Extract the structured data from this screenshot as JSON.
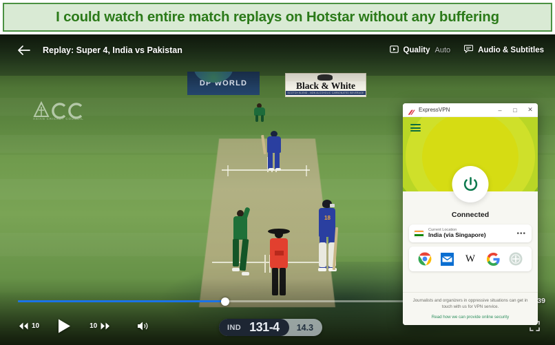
{
  "banner": {
    "text": "I could watch entire match replays on Hotstar without any buffering"
  },
  "player": {
    "back_icon": "back-arrow-icon",
    "title": "Replay: Super 4, India vs Pakistan",
    "quality": {
      "icon": "quality-icon",
      "label": "Quality",
      "value": "Auto"
    },
    "audio": {
      "icon": "subtitles-icon",
      "label": "Audio & Subtitles"
    },
    "progress": {
      "percent": 41,
      "time_remaining": "3:39:39"
    },
    "controls": {
      "rewind_label": "10",
      "rewind_icon": "rewind-10-icon",
      "play_icon": "play-icon",
      "forward_label": "10",
      "forward_icon": "forward-10-icon",
      "volume_icon": "volume-icon",
      "fullscreen_icon": "fullscreen-icon"
    },
    "score": {
      "team": "IND",
      "runs": "131-4",
      "overs": "14.3"
    }
  },
  "broadcast": {
    "logo": {
      "text": "ACC",
      "subtitle": "ASIAN CRICKET COUNCIL"
    },
    "ads": [
      {
        "name": "DP WORLD"
      },
      {
        "name": "Black & White",
        "tagline": "SCOTCH BLEND - NON ALCOHOLIC CARBONATED BEVERAGE"
      }
    ]
  },
  "vpn": {
    "app_name": "ExpressVPN",
    "logo_icon": "expressvpn-logo-icon",
    "window_buttons": {
      "minimize": "–",
      "maximize": "□",
      "close": "✕"
    },
    "menu_icon": "hamburger-menu-icon",
    "power_icon": "power-icon",
    "status": "Connected",
    "location": {
      "caption": "Current Location",
      "value": "India (via Singapore)",
      "flag_icon": "india-flag-icon",
      "more_icon": "more-options-icon",
      "flag_colors": [
        "#FF9933",
        "#FFFFFF",
        "#138808"
      ]
    },
    "shortcuts": [
      {
        "name": "chrome-icon"
      },
      {
        "name": "mail-icon"
      },
      {
        "name": "wikipedia-icon"
      },
      {
        "name": "google-icon"
      },
      {
        "name": "add-shortcut-icon"
      }
    ],
    "footer": {
      "text": "Journalists and organizers in oppressive situations can get in touch with us for VPN service.",
      "link": "Read how we can provide online security"
    }
  },
  "colors": {
    "banner_bg": "#d9ead4",
    "banner_border": "#4a9141",
    "banner_text": "#2b7a19",
    "progress_fill": "#1a73e8",
    "vpn_green": "#8abd1c",
    "vpn_power": "#0d7a4e"
  }
}
